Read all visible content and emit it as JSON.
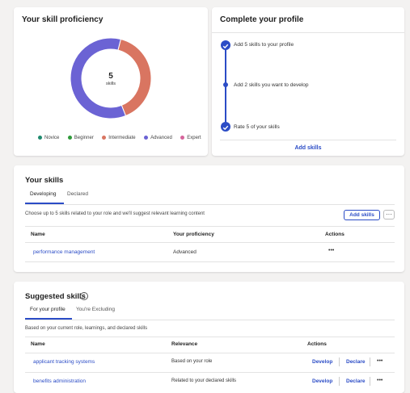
{
  "proficiency": {
    "title": "Your skill proficiency",
    "center_value": "5",
    "center_label": "skills",
    "legend": [
      {
        "label": "Novice",
        "color": "#1e8a6e"
      },
      {
        "label": "Beginner",
        "color": "#2f9a3a"
      },
      {
        "label": "Intermediate",
        "color": "#d97561"
      },
      {
        "label": "Advanced",
        "color": "#6b63d4"
      },
      {
        "label": "Expert",
        "color": "#d6649b"
      }
    ],
    "donut": [
      {
        "label": "Intermediate",
        "count": 2,
        "color": "#d97561"
      },
      {
        "label": "Advanced",
        "count": 3,
        "color": "#6b63d4"
      }
    ]
  },
  "profile": {
    "title": "Complete your profile",
    "steps": [
      {
        "label": "Add 5 skills to your profile",
        "done": true
      },
      {
        "label": "Add 2 skills you want to develop",
        "done": false
      },
      {
        "label": "Rate 5 of your skills",
        "done": true
      }
    ],
    "cta": "Add skills"
  },
  "your_skills": {
    "title": "Your skills",
    "tabs": [
      "Developing",
      "Declared"
    ],
    "hint": "Choose up to 5 skills related to your role and we'll suggest relevant learning content",
    "add_button": "Add skills",
    "more_button": "···",
    "columns": [
      "Name",
      "Your proficiency",
      "Actions"
    ],
    "rows": [
      {
        "name": "performance management",
        "proficiency": "Advanced",
        "actions": "•••"
      }
    ]
  },
  "suggested": {
    "title": "Suggested skills",
    "info_icon": "i",
    "tabs": [
      "For your profile",
      "You're Excluding"
    ],
    "hint": "Based on your current role, learnings, and declared skills",
    "columns": [
      "Name",
      "Relevance",
      "Actions"
    ],
    "rows": [
      {
        "name": "applicant tracking systems",
        "relevance": "Based on your role",
        "develop": "Develop",
        "declare": "Declare",
        "more": "•••"
      },
      {
        "name": "benefits administration",
        "relevance": "Related to your declared skills",
        "develop": "Develop",
        "declare": "Declare",
        "more": "•••"
      }
    ]
  }
}
